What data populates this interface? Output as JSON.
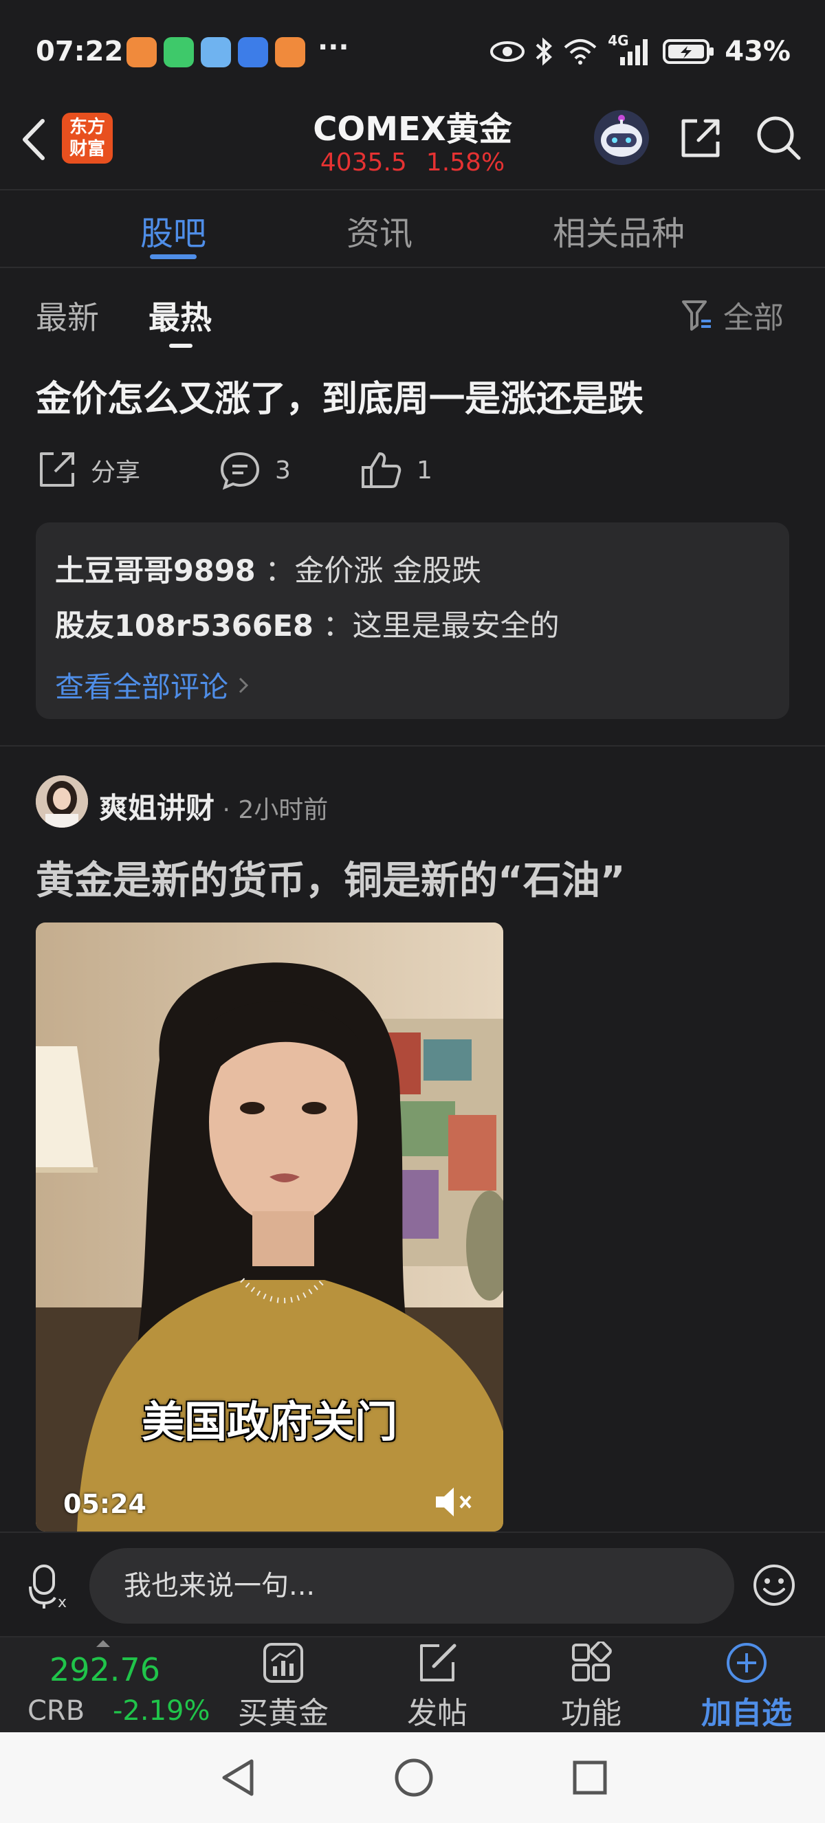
{
  "status_bar": {
    "time": "07:22",
    "more": "···",
    "network": "4G",
    "battery": "43%"
  },
  "header": {
    "logo_line1": "东方",
    "logo_line2": "财富",
    "title": "COMEX黄金",
    "price": "4035.5",
    "change": "1.58%"
  },
  "main_tabs": [
    {
      "label": "股吧",
      "active": true
    },
    {
      "label": "资讯",
      "active": false
    },
    {
      "label": "相关品种",
      "active": false
    }
  ],
  "sub_tabs": [
    {
      "label": "最新",
      "active": false
    },
    {
      "label": "最热",
      "active": true
    }
  ],
  "filter_label": "全部",
  "post1": {
    "title": "金价怎么又涨了，到底周一是涨还是跌",
    "share_label": "分享",
    "comment_count": "3",
    "like_count": "1",
    "comments": [
      {
        "user": "土豆哥哥9898",
        "text": "：金价涨 金股跌"
      },
      {
        "user": "股友108r5366E8",
        "text": "：这里是最安全的"
      }
    ],
    "see_all": "查看全部评论"
  },
  "post2": {
    "author": "爽姐讲财",
    "time": " · 2小时前",
    "title": "黄金是新的货币，铜是新的“石油”",
    "video_caption": "美国政府关门",
    "video_duration": "05:24"
  },
  "input": {
    "placeholder": "我也来说一句..."
  },
  "toolbar": {
    "quote_price": "292.76",
    "quote_name": "CRB",
    "quote_change": "-2.19%",
    "buy_gold": "买黄金",
    "post": "发帖",
    "functions": "功能",
    "add_watchlist": "加自选"
  },
  "colors": {
    "accent": "#4f8ee8",
    "up": "#e63232",
    "down": "#20c44a",
    "logo": "#e8501f"
  }
}
